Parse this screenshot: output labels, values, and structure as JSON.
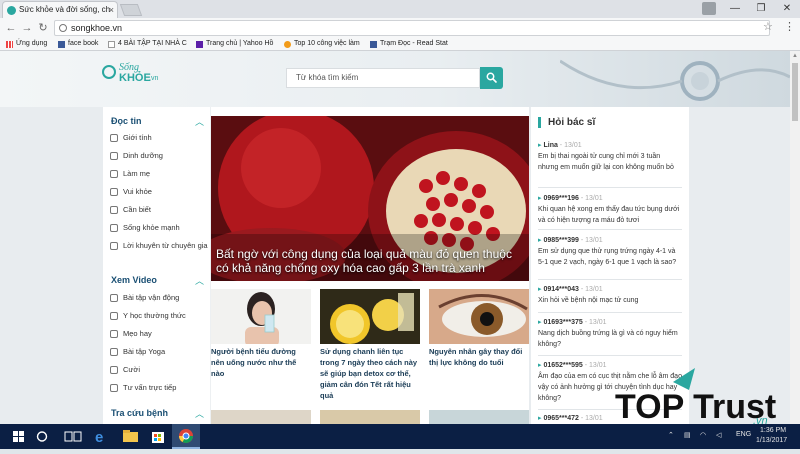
{
  "browser": {
    "tab_title": "Sức khỏe và đời sống, ch",
    "tab_close": "×",
    "url": "songkhoe.vn",
    "window_controls": [
      "—",
      "❐",
      "✕"
    ],
    "bookmarks": [
      {
        "label": "Ứng dụng",
        "icon": "apps-icon"
      },
      {
        "label": "face book",
        "icon": "facebook-icon"
      },
      {
        "label": "4 BÀI TẬP TẠI NHÀ C",
        "icon": "page-icon"
      },
      {
        "label": "Trang chủ | Yahoo Hồ",
        "icon": "yahoo-icon"
      },
      {
        "label": "Top 10 công việc làm",
        "icon": "toptrust-icon"
      },
      {
        "label": "Trạm Đọc - Read Stat",
        "icon": "facebook-icon"
      }
    ]
  },
  "site": {
    "logo": {
      "line1": "Sống",
      "line2": "KHỎE",
      "suffix": ".vn"
    },
    "search_placeholder": "Từ khóa tìm kiếm",
    "accent": "#2aa7a0",
    "left_sections": [
      {
        "title": "Đọc tin",
        "items": [
          "Giới tính",
          "Dinh dưỡng",
          "Làm mẹ",
          "Vui khỏe",
          "Cần biết",
          "Sống khỏe mạnh",
          "Lời khuyên từ chuyên gia"
        ]
      },
      {
        "title": "Xem Video",
        "items": [
          "Bài tập vận động",
          "Y học thường thức",
          "Mẹo hay",
          "Bài tập Yoga",
          "Cười",
          "Tư vấn trực tiếp"
        ]
      },
      {
        "title": "Tra cứu bệnh",
        "items": []
      }
    ],
    "hero_caption": "Bất ngờ với công dụng của loại quả màu đỏ quen thuộc có khả năng chống oxy hóa cao gấp 3 lần trà xanh",
    "articles": [
      {
        "title": "Người bệnh tiểu đường nên uống nước như thế nào"
      },
      {
        "title": "Sử dụng chanh liên tục trong 7 ngày theo cách này sẽ giúp bạn detox cơ thể, giảm cân đón Tết rất hiệu quả"
      },
      {
        "title": "Nguyên nhân gây thay đổi thị lực không do tuổi"
      }
    ],
    "ask_doctor": {
      "title": "Hỏi bác sĩ",
      "questions": [
        {
          "name": "Lina",
          "date": "13/01",
          "text": "Em bị thai ngoài tử cung chỉ mới 3 tuần nhưng em muốn giữ lại con không muốn bỏ"
        },
        {
          "name": "0969***196",
          "date": "13/01",
          "text": "Khi quan hệ xong em thấy đau tức bụng dưới và có hiện tượng ra máu đỏ tươi"
        },
        {
          "name": "0985***399",
          "date": "13/01",
          "text": "Em sử dụng que thử rụng trứng ngày 4-1 và 5-1 que 2 vạch, ngày 6-1 que 1 vạch là sao?"
        },
        {
          "name": "0914***043",
          "date": "13/01",
          "text": "Xin hỏi về bệnh nội mạc tử cung"
        },
        {
          "name": "01693***375",
          "date": "13/01",
          "text": "Nang dịch buồng trứng là gì và có nguy hiểm không?"
        },
        {
          "name": "01652***595",
          "date": "13/01",
          "text": "Âm đạo của em có cục thịt nằm che lỗ âm đạo vậy có ảnh hưởng gì tới chuyện tình dục hay không?"
        },
        {
          "name": "0965***472",
          "date": "13/01",
          "text": ""
        }
      ]
    }
  },
  "watermark": {
    "text": "TOP Trust",
    "suffix": ".vn"
  },
  "taskbar": {
    "tray_lang": "ENG",
    "time": "1:36 PM",
    "date": "1/13/2017"
  }
}
